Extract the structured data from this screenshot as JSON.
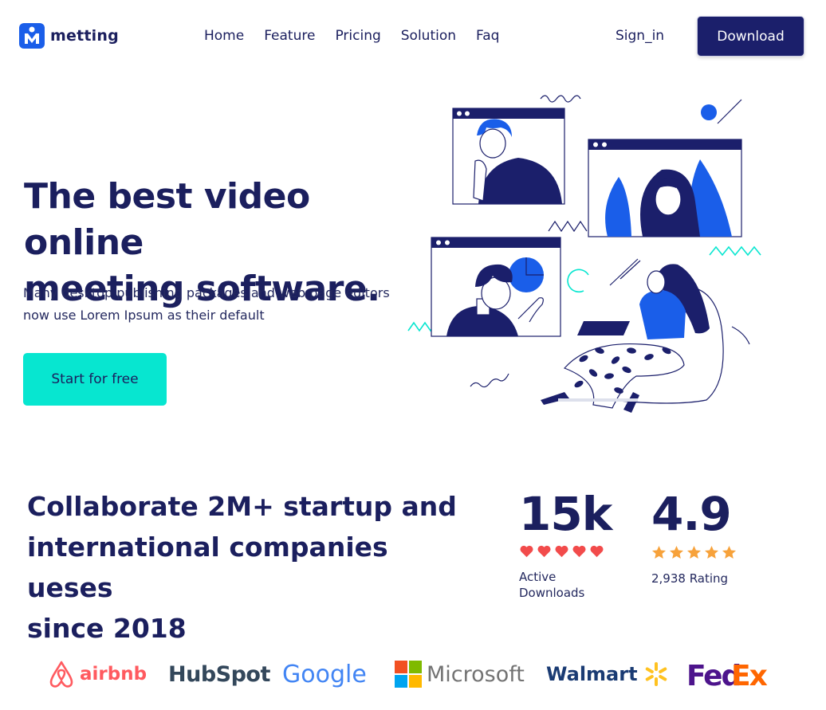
{
  "brand": {
    "name": "metting",
    "accent": "#1a5ee9",
    "navy": "#1b1f6b",
    "teal": "#07e6d0"
  },
  "nav": {
    "items": [
      "Home",
      "Feature",
      "Pricing",
      "Solution",
      "Faq"
    ],
    "signin": "Sign_in",
    "download": "Download"
  },
  "hero": {
    "title_line1": "The best video online",
    "title_line2": "meeting software.",
    "subtitle_line1": "Many desktop publishing packages and web page editors",
    "subtitle_line2": "now use Lorem Ipsum as their default",
    "cta": "Start for free"
  },
  "stats": {
    "headline_line1": "Collaborate 2M+ startup and",
    "headline_line2": "international companies ueses",
    "headline_line3": "since 2018",
    "downloads": {
      "value": "15k",
      "label_line1": "Active",
      "label_line2": "Downloads",
      "icon": "heart-icon",
      "icon_count": 5,
      "icon_color": "#f24b4b"
    },
    "rating": {
      "value": "4.9",
      "label": "2,938 Rating",
      "icon": "star-icon",
      "icon_count": 5,
      "icon_color": "#f7a23b"
    }
  },
  "brands": [
    {
      "name": "airbnb",
      "color": "#ff5a5f"
    },
    {
      "name": "HubSpot",
      "color": "#33475b"
    },
    {
      "name": "Google",
      "color": "#4285f4"
    },
    {
      "name": "Microsoft",
      "color": "#737373"
    },
    {
      "name": "Walmart",
      "color": "#1a3b73"
    },
    {
      "name": "FedEx",
      "color": "#4d148c"
    }
  ]
}
